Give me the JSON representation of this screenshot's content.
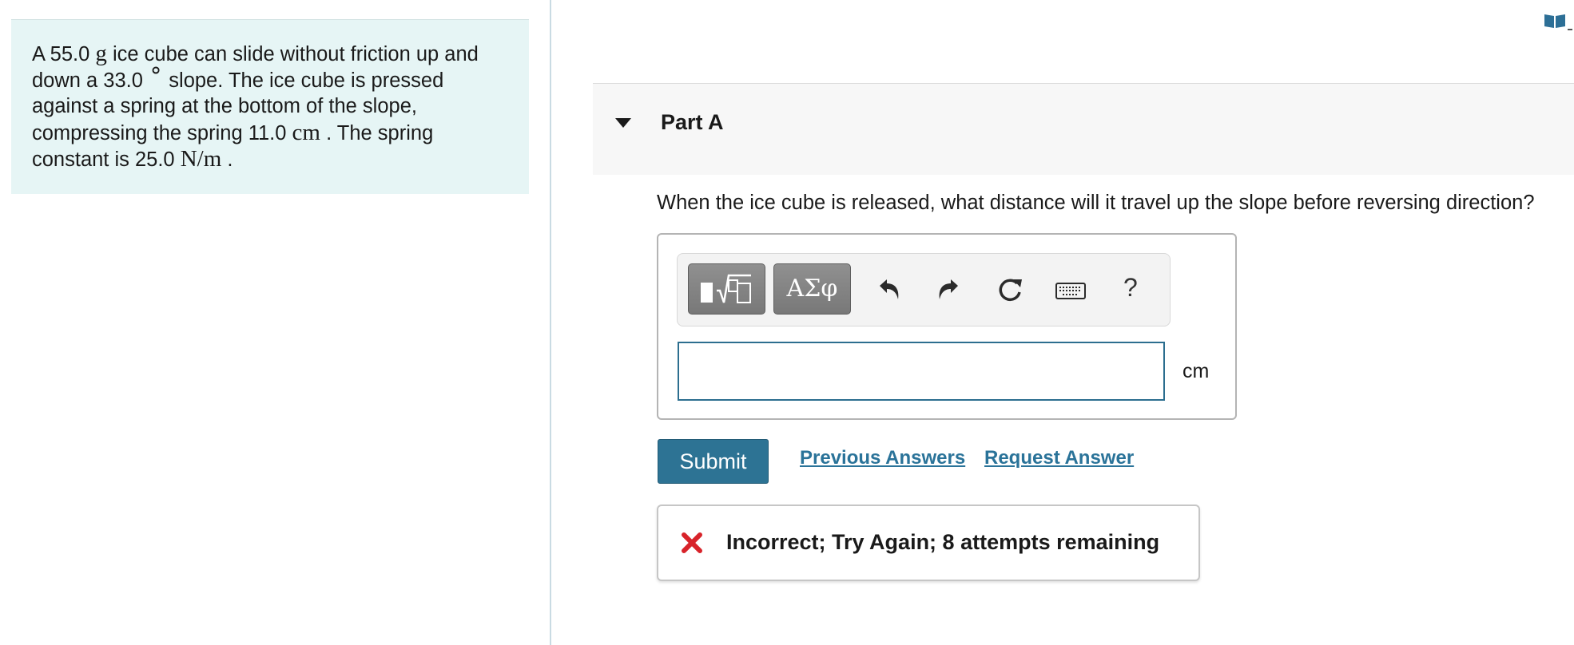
{
  "problem": {
    "t1": "A 55.0 ",
    "m_g": "g",
    "t2": " ice cube can slide without friction up and down a 33.0 ",
    "deg": "∘",
    "t3": " slope. The ice cube is pressed against a spring at the bottom of the slope, compressing the spring 11.0 ",
    "m_cm": "cm",
    "t4": " . The spring constant is 25.0 ",
    "m_nm": "N/m",
    "t5": " ."
  },
  "part": {
    "title": "Part A"
  },
  "question": "When the ice cube is released, what distance will it travel up the slope before reversing direction?",
  "toolbar": {
    "greek_label": "ΑΣφ",
    "help_label": "?",
    "icons": [
      "templates-icon",
      "greek-letters-icon",
      "undo-icon",
      "redo-icon",
      "reset-icon",
      "keyboard-icon",
      "help-icon"
    ]
  },
  "answer": {
    "value": "",
    "unit": "cm"
  },
  "actions": {
    "submit": "Submit",
    "previous_answers": "Previous Answers",
    "request_answer": "Request Answer"
  },
  "feedback": {
    "text": "Incorrect; Try Again; 8 attempts remaining",
    "icon": "x-icon"
  },
  "colors": {
    "problem_bg": "#e6f5f5",
    "primary": "#2d7394",
    "link": "#2a7399",
    "error": "#d8232a",
    "input_border": "#2c6e8f"
  }
}
